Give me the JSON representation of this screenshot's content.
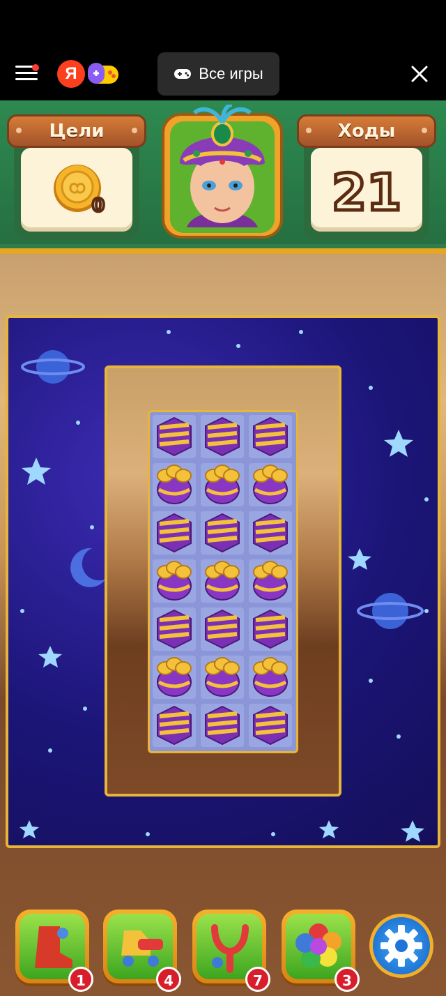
{
  "topbar": {
    "brand_letter": "Я",
    "all_games_label": "Все игры"
  },
  "hud": {
    "goals_label": "Цели",
    "goal_coins": "0",
    "moves_label": "Ходы",
    "moves_value": "21"
  },
  "board": {
    "rows": [
      [
        "vase",
        "vase",
        "vase"
      ],
      [
        "lamp",
        "lamp",
        "lamp"
      ],
      [
        "vase",
        "vase",
        "vase"
      ],
      [
        "lamp",
        "lamp",
        "lamp"
      ],
      [
        "vase",
        "vase",
        "vase"
      ],
      [
        "lamp",
        "lamp",
        "lamp"
      ],
      [
        "vase",
        "vase",
        "vase"
      ]
    ]
  },
  "boosters": [
    {
      "icon": "boot-icon",
      "count": "1"
    },
    {
      "icon": "toy-horse-icon",
      "count": "4"
    },
    {
      "icon": "slingshot-icon",
      "count": "7"
    },
    {
      "icon": "rainbow-flower-icon",
      "count": "3"
    }
  ],
  "colors": {
    "hud_green": "#2d8a50",
    "gold_border": "#e6b53a",
    "board_space": "#1b1577"
  }
}
